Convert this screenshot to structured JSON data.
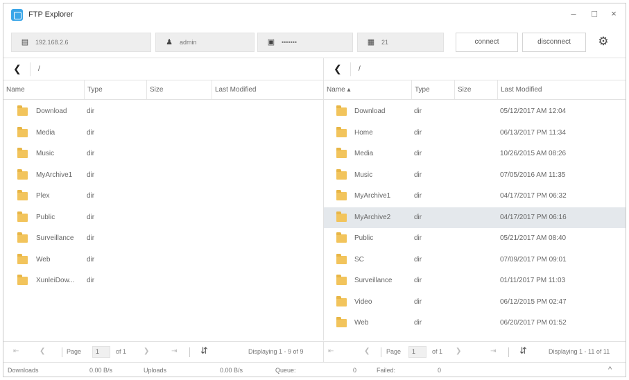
{
  "app": {
    "title": "FTP Explorer"
  },
  "window_controls": {
    "minimize": "–",
    "maximize": "□",
    "close": "×"
  },
  "toolbar": {
    "host": "192.168.2.6",
    "user": "admin",
    "password": "•••••••",
    "port": "21",
    "connect_label": "connect",
    "disconnect_label": "disconnect",
    "host_icon": "server-icon",
    "user_icon": "user-icon",
    "password_icon": "lock-icon",
    "port_icon": "port-icon",
    "settings_icon": "gear-icon"
  },
  "left": {
    "path": "/",
    "columns": [
      "Name",
      "Type",
      "Size",
      "Last Modified"
    ],
    "rows": [
      {
        "name": "Download",
        "type": "dir"
      },
      {
        "name": "Media",
        "type": "dir"
      },
      {
        "name": "Music",
        "type": "dir"
      },
      {
        "name": "MyArchive1",
        "type": "dir"
      },
      {
        "name": "Plex",
        "type": "dir"
      },
      {
        "name": "Public",
        "type": "dir"
      },
      {
        "name": "Surveillance",
        "type": "dir"
      },
      {
        "name": "Web",
        "type": "dir"
      },
      {
        "name": "XunleiDow...",
        "type": "dir"
      }
    ],
    "pager": {
      "page_label": "Page",
      "page": "1",
      "of": "of 1",
      "displaying": "Displaying 1 - 9 of 9"
    }
  },
  "right": {
    "path": "/",
    "columns": [
      "Name ▴",
      "Type",
      "Size",
      "Last Modified"
    ],
    "rows": [
      {
        "name": "Download",
        "type": "dir",
        "modified": "05/12/2017 AM 12:04"
      },
      {
        "name": "Home",
        "type": "dir",
        "modified": "06/13/2017 PM 11:34"
      },
      {
        "name": "Media",
        "type": "dir",
        "modified": "10/26/2015 AM 08:26"
      },
      {
        "name": "Music",
        "type": "dir",
        "modified": "07/05/2016 AM 11:35"
      },
      {
        "name": "MyArchive1",
        "type": "dir",
        "modified": "04/17/2017 PM 06:32"
      },
      {
        "name": "MyArchive2",
        "type": "dir",
        "modified": "04/17/2017 PM 06:16",
        "selected": true
      },
      {
        "name": "Public",
        "type": "dir",
        "modified": "05/21/2017 AM 08:40"
      },
      {
        "name": "SC",
        "type": "dir",
        "modified": "07/09/2017 PM 09:01"
      },
      {
        "name": "Surveillance",
        "type": "dir",
        "modified": "01/11/2017 PM 11:03"
      },
      {
        "name": "Video",
        "type": "dir",
        "modified": "06/12/2015 PM 02:47"
      },
      {
        "name": "Web",
        "type": "dir",
        "modified": "06/20/2017 PM 01:52"
      }
    ],
    "pager": {
      "page_label": "Page",
      "page": "1",
      "of": "of 1",
      "displaying": "Displaying 1 - 11 of 11"
    }
  },
  "status": {
    "downloads_label": "Downloads",
    "downloads_value": "0.00 B/s",
    "uploads_label": "Uploads",
    "uploads_value": "0.00 B/s",
    "queue_label": "Queue:",
    "queue_value": "0",
    "failed_label": "Failed:",
    "failed_value": "0"
  },
  "colors": {
    "accent": "#3aa6e8",
    "folder": "#f2c45c",
    "selected_row": "#e4e8ec"
  }
}
